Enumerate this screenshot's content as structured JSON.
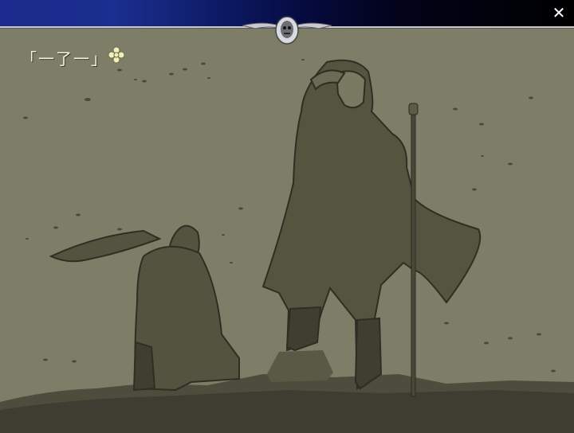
{
  "window": {
    "close_glyph": "✕",
    "colors": {
      "titlebar_start": "#1b2a8c",
      "titlebar_end": "#000000",
      "scene_bg": "#7d7c66"
    }
  },
  "dialogue": {
    "text": "「一了一」",
    "advance_icon": "clover-advance-icon"
  },
  "scene": {
    "description_icon": "scene-illustration",
    "emblem_icon": "skull-emblem-icon"
  }
}
